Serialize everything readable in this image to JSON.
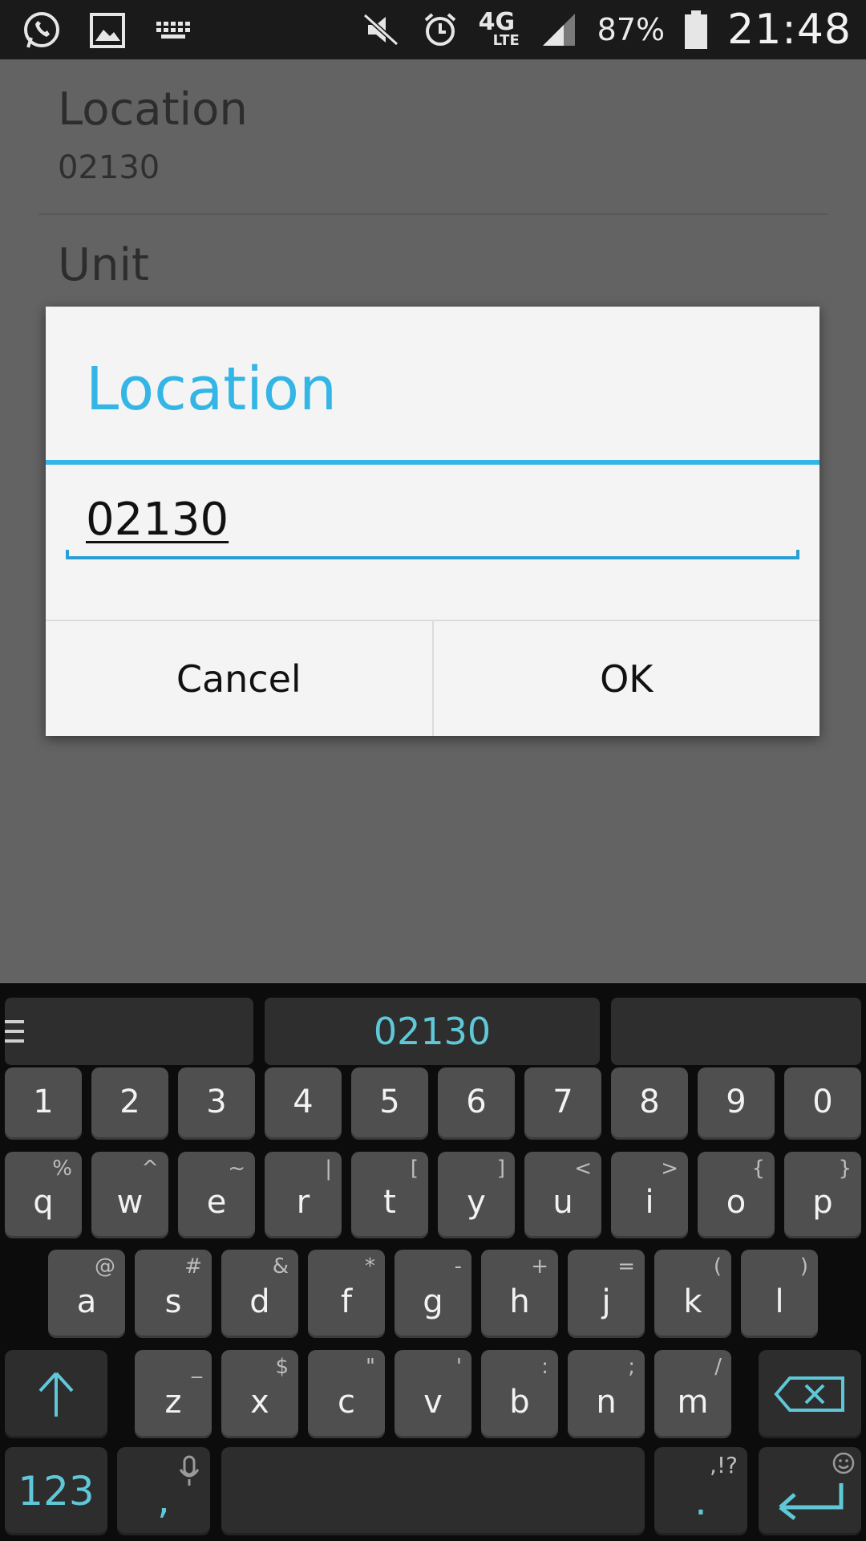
{
  "status_bar": {
    "battery": "87%",
    "time": "21:48",
    "network": "4G",
    "network_sub": "LTE",
    "icons": [
      "whatsapp-icon",
      "gallery-icon",
      "keyboard-icon",
      "mute-icon",
      "alarm-icon",
      "signal-icon",
      "battery-icon"
    ]
  },
  "background_list": {
    "item1_title": "Location",
    "item1_value": "02130",
    "item2_title": "Unit"
  },
  "dialog": {
    "title": "Location",
    "input_value": "02130",
    "cancel_label": "Cancel",
    "ok_label": "OK",
    "accent_color": "#33b5e5"
  },
  "keyboard": {
    "suggestion": "02130",
    "number_row": [
      "1",
      "2",
      "3",
      "4",
      "5",
      "6",
      "7",
      "8",
      "9",
      "0"
    ],
    "row1": [
      {
        "key": "q",
        "sub": "%"
      },
      {
        "key": "w",
        "sub": "^"
      },
      {
        "key": "e",
        "sub": "~"
      },
      {
        "key": "r",
        "sub": "|"
      },
      {
        "key": "t",
        "sub": "["
      },
      {
        "key": "y",
        "sub": "]"
      },
      {
        "key": "u",
        "sub": "<"
      },
      {
        "key": "i",
        "sub": ">"
      },
      {
        "key": "o",
        "sub": "{"
      },
      {
        "key": "p",
        "sub": "}"
      }
    ],
    "row2": [
      {
        "key": "a",
        "sub": "@"
      },
      {
        "key": "s",
        "sub": "#"
      },
      {
        "key": "d",
        "sub": "&"
      },
      {
        "key": "f",
        "sub": "*"
      },
      {
        "key": "g",
        "sub": "-"
      },
      {
        "key": "h",
        "sub": "+"
      },
      {
        "key": "j",
        "sub": "="
      },
      {
        "key": "k",
        "sub": "("
      },
      {
        "key": "l",
        "sub": ")"
      }
    ],
    "row3": [
      {
        "key": "z",
        "sub": "_"
      },
      {
        "key": "x",
        "sub": "$"
      },
      {
        "key": "c",
        "sub": "\""
      },
      {
        "key": "v",
        "sub": "'"
      },
      {
        "key": "b",
        "sub": ":"
      },
      {
        "key": "n",
        "sub": ";"
      },
      {
        "key": "m",
        "sub": "/"
      }
    ],
    "symbols_label": "123",
    "comma": ",",
    "period": ".",
    "period_sub": ",!?",
    "accent_color": "#5ec8d8"
  }
}
